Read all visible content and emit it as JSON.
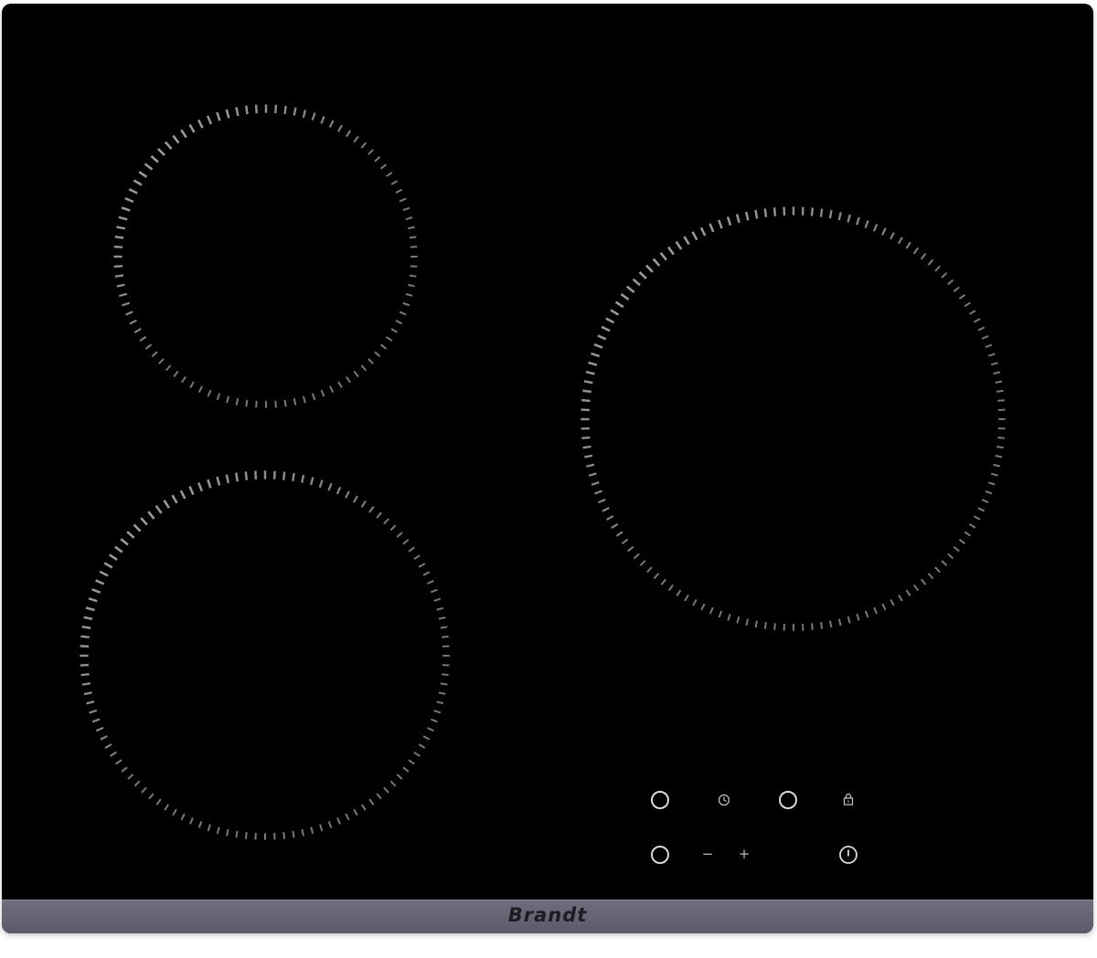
{
  "brand": {
    "name": "Brandt"
  },
  "hob": {
    "glass_color": "#000000",
    "frame_color": "#6a6979",
    "ring_color": "#9a9a9a",
    "zones": [
      {
        "name": "rear-left-zone"
      },
      {
        "name": "front-left-zone"
      },
      {
        "name": "right-zone"
      }
    ]
  },
  "controls": {
    "minus_symbol": "−",
    "plus_symbol": "+",
    "icons": {
      "zone_select_1": "circle-icon",
      "timer": "timer-icon",
      "zone_select_2": "circle-icon",
      "lock": "lock-icon",
      "zone_select_3": "circle-icon",
      "power": "power-icon"
    }
  }
}
